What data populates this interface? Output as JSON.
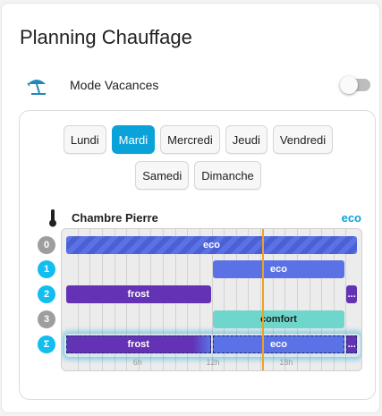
{
  "card": {
    "title": "Planning Chauffage",
    "vacation": {
      "label": "Mode Vacances",
      "enabled": false,
      "icon": "beach-umbrella-icon"
    }
  },
  "days": {
    "row1": [
      "Lundi",
      "Mardi",
      "Mercredi",
      "Jeudi",
      "Vendredi"
    ],
    "row2": [
      "Samedi",
      "Dimanche"
    ],
    "selected": "Mardi"
  },
  "room": {
    "name": "Chambre Pierre",
    "current_mode": "eco",
    "icon": "thermometer-icon"
  },
  "schedule": {
    "hour_labels": [
      "6h",
      "12h",
      "18h"
    ],
    "current_time": "16:10",
    "rows": [
      {
        "badge": "0",
        "blocks": [
          {
            "label": "eco",
            "start": "00:00",
            "end": "24:00",
            "mode": "eco-hatched"
          }
        ]
      },
      {
        "badge": "1",
        "blocks": [
          {
            "label": "eco",
            "start": "12:00",
            "end": "23:00",
            "mode": "eco"
          }
        ]
      },
      {
        "badge": "2",
        "blocks": [
          {
            "label": "frost",
            "start": "00:00",
            "end": "12:00",
            "mode": "frost"
          },
          {
            "label": "...",
            "start": "23:00",
            "end": "24:00",
            "mode": "frost"
          }
        ]
      },
      {
        "badge": "3",
        "blocks": [
          {
            "label": "comfort",
            "start": "12:00",
            "end": "23:00",
            "mode": "comfort"
          }
        ]
      },
      {
        "badge": "Σ",
        "blocks": [
          {
            "label": "frost",
            "start": "00:00",
            "end": "12:00",
            "mode": "frost"
          },
          {
            "label": "eco",
            "start": "12:00",
            "end": "23:00",
            "mode": "eco"
          },
          {
            "label": "...",
            "start": "23:00",
            "end": "24:00",
            "mode": "frost"
          }
        ]
      }
    ]
  },
  "colors": {
    "accent": "#0aa3d9",
    "eco": "#5a72e6",
    "frost": "#6432b4",
    "comfort": "#6fd6cb",
    "now_line": "#f0a21e"
  }
}
